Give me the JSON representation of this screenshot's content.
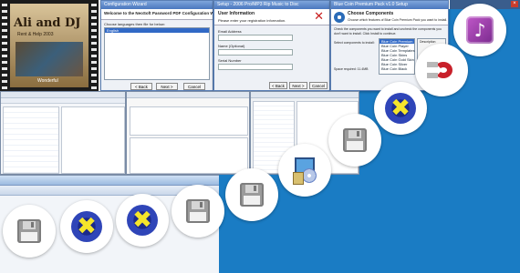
{
  "colors": {
    "background": "#1a7cc4",
    "circle": "#ffffff",
    "title_bar": "#4a77be",
    "selection": "#3169c6"
  },
  "poster": {
    "title_line1": "Ali and DJ",
    "title_line2": "Rent & Help 2003",
    "caption": "Wonderful"
  },
  "windows": {
    "config_wizard": {
      "title": "Configuration Wizard",
      "heading": "Welcome to the NeoSoft Password PDF Configuration Wizard",
      "prompt": "Choose languages then file for below:",
      "back_button": "< Back",
      "next_button": "Next >",
      "cancel_button": "Cancel"
    },
    "user_info": {
      "title": "Setup - 2006 Pro/MP3 Rip Music to Disc",
      "heading": "User Information",
      "subheading": "Please enter your registration information.",
      "email_label": "Email Address",
      "name_label": "Name (Optional)",
      "serial_label": "Serial Number",
      "back_button": "< Back",
      "next_button": "Next >",
      "cancel_button": "Cancel"
    },
    "components": {
      "title": "Blue Coin Premium Pack v1.0 Setup",
      "heading": "Choose Components",
      "subheading": "Choose which features of Blue Coin Premium Pack you want to install.",
      "instructions": "Check the components you want to install and uncheck the components you don't want to install. Click Install to continue.",
      "select_label": "Select components to install:",
      "description_label": "Description",
      "space_label": "Space required: 11.4MB",
      "items": [
        "Blue Coin Premium",
        "Blue Coin Player",
        "Blue Coin Templates",
        "Blue Coin Skins",
        "Blue Coin Gold Skin",
        "Blue Coin Silver",
        "Blue Coin Black"
      ]
    }
  },
  "icons": [
    "floppy-disk-icon",
    "yellow-x-badge-icon",
    "yellow-x-badge-icon",
    "floppy-disk-icon",
    "floppy-disk-icon",
    "software-installer-icon",
    "floppy-disk-icon",
    "yellow-x-badge-icon",
    "magnet-icon",
    "music-file-icon"
  ]
}
